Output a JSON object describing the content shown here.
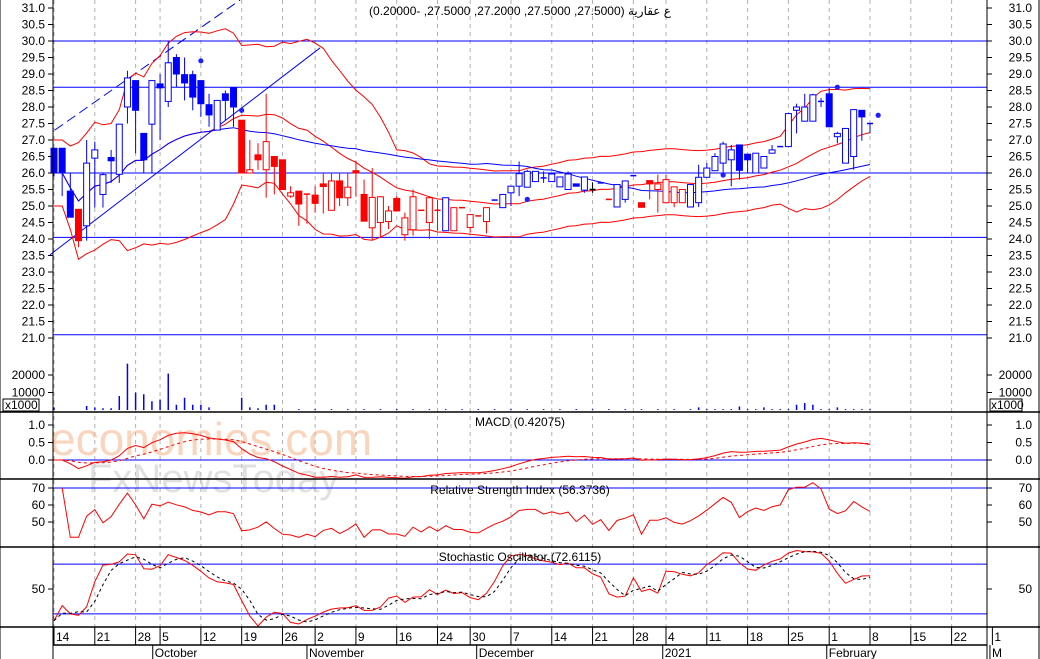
{
  "chart_data": {
    "type": "candlestick",
    "title": "ع عقارية (27.5000, 27.5000, 27.2000, 27.5000, -0.20000)",
    "colors": {
      "b": "#0000ff",
      "r": "#ff0000",
      "k": "#000000",
      "level": "#0000ff",
      "band": "#ff0000",
      "ma": "#0000ff"
    },
    "price_axis": {
      "ylim": [
        21.0,
        31.0
      ],
      "ticks": [
        "21.0",
        "21.5",
        "22.0",
        "22.5",
        "23.0",
        "23.5",
        "24.0",
        "24.5",
        "25.0",
        "25.5",
        "26.0",
        "26.5",
        "27.0",
        "27.5",
        "28.0",
        "28.5",
        "29.0",
        "29.5",
        "30.0",
        "30.5",
        "31.0"
      ]
    },
    "candles_ohlc_color": [
      [
        26.75,
        26.75,
        25.9,
        26.0,
        "b"
      ],
      [
        26.75,
        26.75,
        25.3,
        26.0,
        "b"
      ],
      [
        25.45,
        26.0,
        24.66,
        24.66,
        "b"
      ],
      [
        24.9,
        24.9,
        23.75,
        23.95,
        "r"
      ],
      [
        24.4,
        27.0,
        23.95,
        26.3,
        "b"
      ],
      [
        26.45,
        26.95,
        24.95,
        26.7,
        "b"
      ],
      [
        25.35,
        26.0,
        24.95,
        25.95,
        "b"
      ],
      [
        26.47,
        26.7,
        25.7,
        26.37,
        "b"
      ],
      [
        25.96,
        27.48,
        25.7,
        27.48,
        "b"
      ],
      [
        28.0,
        29.1,
        27.5,
        28.88,
        "b"
      ],
      [
        28.8,
        28.8,
        26.6,
        27.9,
        "b"
      ],
      [
        27.2,
        27.2,
        26.0,
        26.4,
        "b"
      ],
      [
        27.48,
        28.8,
        26.0,
        28.8,
        "b"
      ],
      [
        28.7,
        29.0,
        27.0,
        28.58,
        "b"
      ],
      [
        28.17,
        30.0,
        28.0,
        29.34,
        "b"
      ],
      [
        29.5,
        29.6,
        28.6,
        29.0,
        "b"
      ],
      [
        28.98,
        29.5,
        28.2,
        28.73,
        "b"
      ],
      [
        28.98,
        29.1,
        27.9,
        28.3,
        "b"
      ],
      [
        28.8,
        28.8,
        27.7,
        28.1,
        "b"
      ],
      [
        28.07,
        28.4,
        27.4,
        27.76,
        "b"
      ],
      [
        27.3,
        28.2,
        27.3,
        28.2,
        "b"
      ],
      [
        28.4,
        28.5,
        27.6,
        28.2,
        "b"
      ],
      [
        28.58,
        28.58,
        27.4,
        28.0,
        "b"
      ],
      [
        27.6,
        27.6,
        26.0,
        26.0,
        "r"
      ],
      [
        26.0,
        27.0,
        26.0,
        26.1,
        "r"
      ],
      [
        26.55,
        26.9,
        26.1,
        26.4,
        "r"
      ],
      [
        26.1,
        28.4,
        25.25,
        26.95,
        "r"
      ],
      [
        26.5,
        26.5,
        25.35,
        26.2,
        "r"
      ],
      [
        26.4,
        26.4,
        25.5,
        25.5,
        "r"
      ],
      [
        25.3,
        25.6,
        25.25,
        25.4,
        "r"
      ],
      [
        25.45,
        25.45,
        24.4,
        25.06,
        "r"
      ],
      [
        25.36,
        25.36,
        24.46,
        25.36,
        "r"
      ],
      [
        25.33,
        25.6,
        24.8,
        25.08,
        "r"
      ],
      [
        25.67,
        26.0,
        24.77,
        25.59,
        "r"
      ],
      [
        24.87,
        26.0,
        24.87,
        25.76,
        "r"
      ],
      [
        25.76,
        26.0,
        25.0,
        25.25,
        "r"
      ],
      [
        25.25,
        26.0,
        25.0,
        25.57,
        "r"
      ],
      [
        26.07,
        26.36,
        25.28,
        26.0,
        "r"
      ],
      [
        25.35,
        25.8,
        24.54,
        24.54,
        "r"
      ],
      [
        24.34,
        26.15,
        23.97,
        25.26,
        "r"
      ],
      [
        24.5,
        25.3,
        24.05,
        25.28,
        "r"
      ],
      [
        24.53,
        25.0,
        24.3,
        24.85,
        "r"
      ],
      [
        25.23,
        25.3,
        24.85,
        24.85,
        "r"
      ],
      [
        24.13,
        24.8,
        23.95,
        24.64,
        "r"
      ],
      [
        24.28,
        25.5,
        24.1,
        25.28,
        "r"
      ],
      [
        24.87,
        24.87,
        24.87,
        24.87,
        "r"
      ],
      [
        24.5,
        25.3,
        24.0,
        25.25,
        "r"
      ],
      [
        24.87,
        25.18,
        24.25,
        24.87,
        "r"
      ],
      [
        24.25,
        25.25,
        24.25,
        25.25,
        "b"
      ],
      [
        24.25,
        24.95,
        24.25,
        24.95,
        "r"
      ],
      [
        24.95,
        24.95,
        24.95,
        24.95,
        "r"
      ],
      [
        24.35,
        24.74,
        24.2,
        24.74,
        "r"
      ],
      [
        24.7,
        24.7,
        24.7,
        24.7,
        "r"
      ],
      [
        24.53,
        24.95,
        24.17,
        24.95,
        "r"
      ],
      [
        25.18,
        25.18,
        25.18,
        25.18,
        "b"
      ],
      [
        24.95,
        25.35,
        24.95,
        25.35,
        "b"
      ],
      [
        25.4,
        25.6,
        25.0,
        25.6,
        "b"
      ],
      [
        25.6,
        26.35,
        25.3,
        25.98,
        "b"
      ],
      [
        25.57,
        26.1,
        25.57,
        26.05,
        "b"
      ],
      [
        25.74,
        26.05,
        25.74,
        26.05,
        "b"
      ],
      [
        25.85,
        26.05,
        25.7,
        25.85,
        "b"
      ],
      [
        25.74,
        26.0,
        25.74,
        25.97,
        "b"
      ],
      [
        25.58,
        25.88,
        25.58,
        25.88,
        "b"
      ],
      [
        25.5,
        26.05,
        25.5,
        25.97,
        "b"
      ],
      [
        25.67,
        25.67,
        25.6,
        25.6,
        "b"
      ],
      [
        25.48,
        25.88,
        25.4,
        25.88,
        "b"
      ],
      [
        25.5,
        25.72,
        25.4,
        25.5,
        "k"
      ],
      [
        25.7,
        25.7,
        25.7,
        25.7,
        "b"
      ],
      [
        25.2,
        25.2,
        25.2,
        25.2,
        "r"
      ],
      [
        24.97,
        25.65,
        24.97,
        25.65,
        "b"
      ],
      [
        25.2,
        25.76,
        25.1,
        25.76,
        "b"
      ],
      [
        25.92,
        25.92,
        25.92,
        25.92,
        "b"
      ],
      [
        25.1,
        25.1,
        24.96,
        24.96,
        "r"
      ],
      [
        25.77,
        25.77,
        25.2,
        25.67,
        "r"
      ],
      [
        25.5,
        25.95,
        24.8,
        25.67,
        "r"
      ],
      [
        25.1,
        25.95,
        25.1,
        25.8,
        "r"
      ],
      [
        25.1,
        25.58,
        24.96,
        25.58,
        "r"
      ],
      [
        25.1,
        25.5,
        25.1,
        25.5,
        "r"
      ],
      [
        24.97,
        25.65,
        24.97,
        25.65,
        "b"
      ],
      [
        25.1,
        26.25,
        24.97,
        25.87,
        "b"
      ],
      [
        25.87,
        26.3,
        25.87,
        26.15,
        "b"
      ],
      [
        26.07,
        26.6,
        26.07,
        26.5,
        "b"
      ],
      [
        26.3,
        26.95,
        25.97,
        26.88,
        "b"
      ],
      [
        26.4,
        26.85,
        25.6,
        26.7,
        "b"
      ],
      [
        26.85,
        26.85,
        25.8,
        26.08,
        "b"
      ],
      [
        26.57,
        26.57,
        26.0,
        26.4,
        "b"
      ],
      [
        26.0,
        26.6,
        26.0,
        26.6,
        "b"
      ],
      [
        26.15,
        26.5,
        26.15,
        26.5,
        "b"
      ],
      [
        26.6,
        26.85,
        26.6,
        26.7,
        "b"
      ],
      [
        26.8,
        26.8,
        26.8,
        26.8,
        "b"
      ],
      [
        26.8,
        27.8,
        26.8,
        27.8,
        "b"
      ],
      [
        27.9,
        28.1,
        27.2,
        28.0,
        "b"
      ],
      [
        27.57,
        28.4,
        27.57,
        28.0,
        "b"
      ],
      [
        27.57,
        28.4,
        27.57,
        28.37,
        "b"
      ],
      [
        28.17,
        28.27,
        28.0,
        28.17,
        "b"
      ],
      [
        28.4,
        28.57,
        27.4,
        27.4,
        "b"
      ],
      [
        27.1,
        27.25,
        26.9,
        27.2,
        "b"
      ],
      [
        26.3,
        27.35,
        26.3,
        27.35,
        "b"
      ],
      [
        26.5,
        27.92,
        26.1,
        27.92,
        "b"
      ],
      [
        27.9,
        27.9,
        26.98,
        27.7,
        "b"
      ],
      [
        27.5,
        27.5,
        27.2,
        27.5,
        "b"
      ]
    ],
    "markers": [
      {
        "index": 18,
        "price": 29.4
      },
      {
        "index": 23,
        "price": 27.9
      },
      {
        "index": 58,
        "price": 25.2
      },
      {
        "index": 82,
        "price": 25.94
      },
      {
        "index": 96,
        "price": 28.6
      },
      {
        "index": 101,
        "price": 27.75
      }
    ],
    "levels": [
      30.0,
      28.6,
      26.0,
      24.05,
      21.1
    ],
    "trendlines": [
      {
        "style": "solid",
        "from": [
          -0.5,
          23.52
        ],
        "to": [
          32.6,
          29.79
        ]
      },
      {
        "style": "dashed",
        "from": [
          0.1,
          27.3
        ],
        "to": [
          22.8,
          31.24
        ]
      }
    ],
    "volume": {
      "unit_label": "x1000",
      "ticks": [
        "10000",
        "20000"
      ],
      "values": [
        1500,
        0,
        0,
        0,
        2300,
        1500,
        1000,
        1000,
        8000,
        26500,
        10000,
        9000,
        5000,
        6000,
        20800,
        3000,
        7000,
        3000,
        3000,
        1500,
        0,
        0,
        0,
        7000,
        1500,
        1000,
        3000,
        3000,
        0,
        0,
        500,
        0,
        500,
        0,
        500,
        0,
        500,
        0,
        500,
        0,
        500,
        0,
        500,
        0,
        500,
        0,
        500,
        0,
        500,
        0,
        500,
        0,
        500,
        0,
        500,
        0,
        500,
        0,
        500,
        0,
        500,
        0,
        500,
        0,
        500,
        0,
        500,
        0,
        500,
        0,
        500,
        0,
        500,
        0,
        500,
        0,
        500,
        0,
        500,
        1500,
        500,
        500,
        500,
        500,
        2000,
        500,
        500,
        1500,
        500,
        500,
        500,
        3000,
        4000,
        3000,
        500,
        500,
        1500,
        500,
        500,
        500,
        500
      ]
    },
    "macd": {
      "label": "MACD (0.42075)",
      "ticks": [
        "0.0",
        "0.5",
        "1.0"
      ]
    },
    "rsi": {
      "label": "Relative Strength Index (56.3736)",
      "ticks": [
        "50",
        "60",
        "70"
      ],
      "level": 70
    },
    "stochastic": {
      "label": "Stochastic Oscillator (72.6115)",
      "ticks": [
        "50"
      ],
      "levels": [
        80,
        20
      ]
    },
    "x_ticks": [
      {
        "label": "14",
        "index": 0
      },
      {
        "label": "21",
        "index": 5
      },
      {
        "label": "28",
        "index": 10
      },
      {
        "label": "5",
        "index": 13
      },
      {
        "label": "12",
        "index": 18
      },
      {
        "label": "19",
        "index": 23
      },
      {
        "label": "26",
        "index": 28
      },
      {
        "label": "2",
        "index": 32
      },
      {
        "label": "9",
        "index": 37
      },
      {
        "label": "16",
        "index": 42
      },
      {
        "label": "24",
        "index": 47
      },
      {
        "label": "30",
        "index": 51
      },
      {
        "label": "7",
        "index": 56
      },
      {
        "label": "14",
        "index": 61
      },
      {
        "label": "21",
        "index": 66
      },
      {
        "label": "28",
        "index": 71
      },
      {
        "label": "4",
        "index": 75
      },
      {
        "label": "11",
        "index": 80
      },
      {
        "label": "18",
        "index": 85
      },
      {
        "label": "25",
        "index": 90
      },
      {
        "label": "1",
        "index": 95
      },
      {
        "label": "8",
        "index": 100
      },
      {
        "label": "15",
        "index": 105
      },
      {
        "label": "22",
        "index": 110
      },
      {
        "label": "1",
        "index": 115
      }
    ],
    "months": [
      {
        "label": "October",
        "index": 12.1
      },
      {
        "label": "November",
        "index": 31
      },
      {
        "label": "December",
        "index": 51.8
      },
      {
        "label": "2021",
        "index": 74.6
      },
      {
        "label": "February",
        "index": 94.7
      },
      {
        "label": "M",
        "index": 114.7
      }
    ]
  },
  "watermark": {
    "line1": "economies.com",
    "line2": "FxNewsToday"
  }
}
